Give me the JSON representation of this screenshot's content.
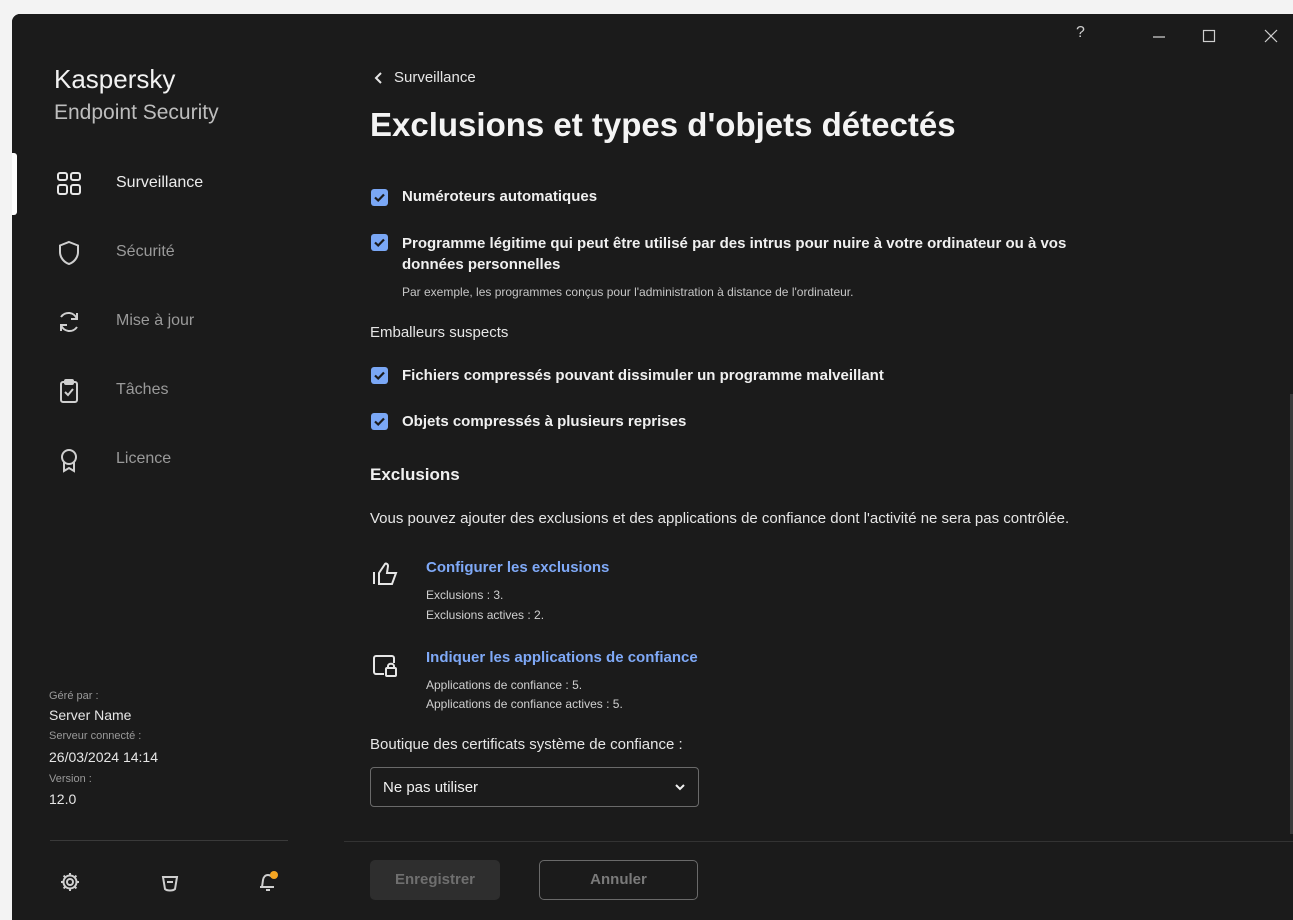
{
  "window": {
    "controls": [
      "help-icon",
      "minimize-icon",
      "maximize-icon",
      "close-icon"
    ],
    "help_label": "?"
  },
  "brand": {
    "line1": "Kaspersky",
    "line2": "Endpoint Security"
  },
  "sidebar": {
    "items": [
      {
        "label": "Surveillance",
        "icon": "dashboard-icon",
        "active": true
      },
      {
        "label": "Sécurité",
        "icon": "shield-icon",
        "active": false
      },
      {
        "label": "Mise à jour",
        "icon": "refresh-icon",
        "active": false
      },
      {
        "label": "Tâches",
        "icon": "clipboard-check-icon",
        "active": false
      },
      {
        "label": "Licence",
        "icon": "license-award-icon",
        "active": false
      }
    ],
    "managed_by_label": "Géré par :",
    "managed_by_value": "Server Name",
    "server_connected_label": "Serveur connecté :",
    "server_connected_value": "26/03/2024 14:14",
    "version_label": "Version :",
    "version_value": "12.0",
    "footer_icons": [
      "settings-gear-icon",
      "support-icon",
      "notifications-bell-icon"
    ]
  },
  "main": {
    "back_label": "Surveillance",
    "title": "Exclusions et types d'objets détectés",
    "checkboxes": [
      {
        "label": "Numéroteurs automatiques",
        "checked": true
      },
      {
        "label_line1": "Programme légitime qui peut être utilisé par des intrus pour nuire à votre ordinateur ou à vos",
        "label_line2": "données personnelles",
        "hint": "Par exemple, les programmes conçus pour l'administration à distance de l'ordinateur.",
        "checked": true
      },
      {
        "label": "Fichiers compressés pouvant dissimuler un programme malveillant",
        "checked": true
      },
      {
        "label": "Objets compressés à plusieurs reprises",
        "checked": true
      }
    ],
    "packers_heading": "Emballeurs suspects",
    "exclusions_heading": "Exclusions",
    "exclusions_desc": "Vous pouvez ajouter des exclusions et des applications de confiance dont l'activité ne sera pas contrôlée.",
    "configure": {
      "link": "Configurer les exclusions",
      "line1": "Exclusions : 3.",
      "line2": "Exclusions actives : 2."
    },
    "trusted": {
      "link": "Indiquer les applications de confiance",
      "line1": "Applications de confiance : 5.",
      "line2": "Applications de confiance actives : 5."
    },
    "cert_store_label": "Boutique des certificats système de confiance :",
    "cert_store_value": "Ne pas utiliser",
    "save_label": "Enregistrer",
    "cancel_label": "Annuler"
  },
  "colors": {
    "accent": "#7aa7f5",
    "link": "#7fa9f7",
    "background": "#1b1b1b",
    "notification_dot": "#f5a623"
  }
}
